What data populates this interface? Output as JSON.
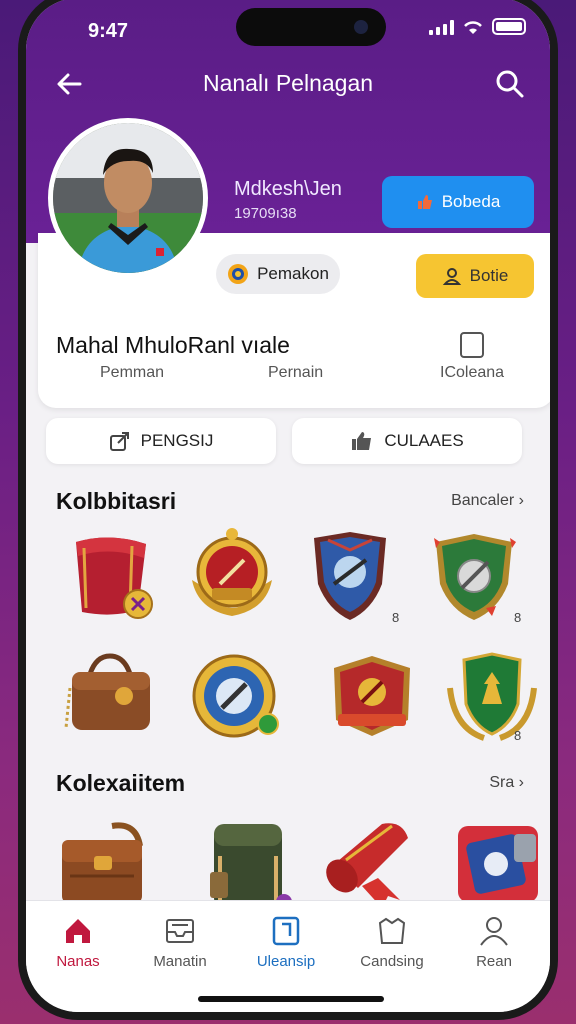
{
  "status": {
    "time": "9:47"
  },
  "header": {
    "title": "Nanalı Pelnagan"
  },
  "profile": {
    "name": "Mdkesh\\Jen",
    "id": "19709ı38",
    "primary_button": "Bobeda",
    "chip": "Pemakon",
    "secondary_button": "Botie"
  },
  "stats": {
    "title": "Mahal MhuloRanl vıale",
    "labels": [
      "Pemman",
      "Pernain",
      "IColeana"
    ]
  },
  "tabs": [
    "PENGSIJ",
    "CULAAES"
  ],
  "sections": {
    "collection": {
      "title": "Kolbbitasri",
      "link": "Bancaler"
    },
    "items": {
      "title": "Kolexaiitem",
      "link": "Sra"
    }
  },
  "badges": {
    "row1_counts": [
      "",
      "",
      "8",
      "8"
    ],
    "row2_counts": [
      "",
      "",
      "",
      "8"
    ]
  },
  "nav": [
    {
      "label": "Nanas",
      "icon": "home-icon",
      "active": true
    },
    {
      "label": "Manatin",
      "icon": "inbox-icon",
      "active": false
    },
    {
      "label": "Uleansip",
      "icon": "card-icon",
      "active": false
    },
    {
      "label": "Candsing",
      "icon": "bag-icon",
      "active": false
    },
    {
      "label": "Rean",
      "icon": "user-icon",
      "active": false
    }
  ],
  "colors": {
    "purple": "#5a1d86",
    "blue_button": "#1f8ff0",
    "yellow_button": "#f6c531",
    "active_nav": "#c0183e",
    "blue_nav": "#1d6fc0"
  }
}
